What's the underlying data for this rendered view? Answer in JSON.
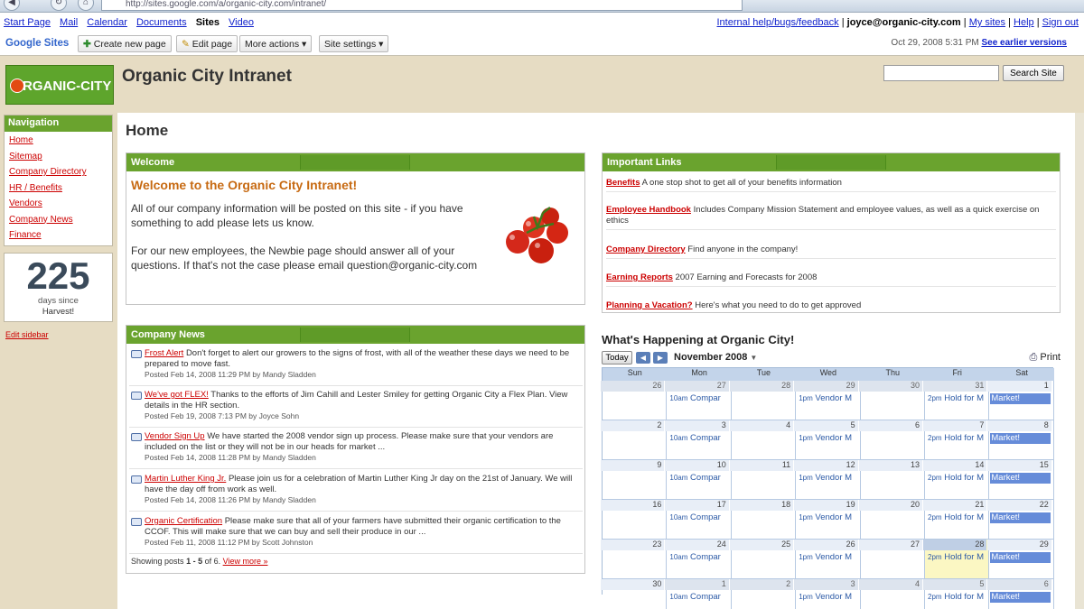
{
  "browser": {
    "url": "http://sites.google.com/a/organic-city.com/intranet/"
  },
  "gbar": {
    "left_links": [
      "Start Page",
      "Mail",
      "Calendar",
      "Documents",
      "Sites",
      "Video"
    ],
    "help_link": "Internal help/bugs/feedback",
    "account": "joyce@organic-city.com",
    "my_sites": "My sites",
    "help": "Help",
    "sign_out": "Sign out"
  },
  "sites_toolbar": {
    "brand": "Google Sites",
    "create_page": "Create new page",
    "edit_page": "Edit page",
    "more_actions": "More actions",
    "site_settings": "Site settings",
    "timestamp": "Oct 29, 2008 5:31 PM",
    "earlier_versions": "See earlier versions"
  },
  "header": {
    "logo_text": "RGANIC-CITY",
    "site_title": "Organic City Intranet",
    "search_placeholder": "",
    "search_button": "Search Site"
  },
  "sidebar": {
    "nav_title": "Navigation",
    "items": [
      "Home",
      "Sitemap",
      "Company Directory",
      "HR / Benefits",
      "Vendors",
      "Company News",
      "Finance"
    ],
    "counter_value": "225",
    "counter_caption1": "days since",
    "counter_caption2": "Harvest!",
    "edit_sidebar": "Edit sidebar"
  },
  "page": {
    "title": "Home"
  },
  "welcome": {
    "header": "Welcome",
    "title": "Welcome to the Organic City Intranet!",
    "para1": "All of our company information will be posted on this site - if you have something to add please lets us know.",
    "para2": "For our new employees, the Newbie page should answer all of your questions. If that's not the case please email question@organic-city.com"
  },
  "news": {
    "header": "Company News",
    "items": [
      {
        "title": "Frost Alert",
        "text": "Don't forget to alert our growers to the signs of frost, with all of the weather these days we need to be prepared to move fast.",
        "meta": "Posted Feb 14, 2008 11:29 PM by Mandy Sladden"
      },
      {
        "title": "We've got FLEX!",
        "text": "Thanks to the efforts of Jim Cahill and Lester Smiley for getting Organic City a Flex Plan. View details in the HR section.",
        "meta": "Posted Feb 19, 2008 7:13 PM by Joyce Sohn"
      },
      {
        "title": "Vendor Sign Up",
        "text": "We have started the 2008 vendor sign up process. Please make sure that your vendors are included on the list or they will not be in our heads for market ...",
        "meta": "Posted Feb 14, 2008 11:28 PM by Mandy Sladden"
      },
      {
        "title": "Martin Luther King Jr.",
        "text": "Please join us for a celebration of Martin Luther King Jr day on the 21st of January. We will have the day off from work as well.",
        "meta": "Posted Feb 14, 2008 11:26 PM by Mandy Sladden"
      },
      {
        "title": "Organic Certification",
        "text": "Please make sure that all of your farmers have submitted their organic certification to the CCOF. This will make sure that we can buy and sell their produce in our ...",
        "meta": "Posted Feb 11, 2008 11:12 PM by Scott Johnston"
      }
    ],
    "footer_prefix": "Showing posts",
    "footer_range": "1 - 5",
    "footer_of": "of 6.",
    "view_more": "View more »"
  },
  "links": {
    "header": "Important Links",
    "items": [
      {
        "title": "Benefits",
        "text": "A one stop shot to get all of your benefits information"
      },
      {
        "title": "Employee Handbook",
        "text": "Includes Company Mission Statement and employee values, as well as a quick exercise on ethics"
      },
      {
        "title": "Company Directory",
        "text": "Find anyone in the company!"
      },
      {
        "title": "Earning Reports",
        "text": "2007 Earning and Forecasts for 2008"
      },
      {
        "title": "Planning a Vacation?",
        "text": "Here's what you need to do to get approved"
      }
    ]
  },
  "calendar": {
    "title": "What's Happening at Organic City!",
    "today": "Today",
    "month": "November 2008",
    "print": "Print",
    "days": [
      "Sun",
      "Mon",
      "Tue",
      "Wed",
      "Thu",
      "Fri",
      "Sat"
    ],
    "weeks": [
      [
        "26",
        "27",
        "28",
        "29",
        "30",
        "31",
        "1"
      ],
      [
        "2",
        "3",
        "4",
        "5",
        "6",
        "7",
        "8"
      ],
      [
        "9",
        "10",
        "11",
        "12",
        "13",
        "14",
        "15"
      ],
      [
        "16",
        "17",
        "18",
        "19",
        "20",
        "21",
        "22"
      ],
      [
        "23",
        "24",
        "25",
        "26",
        "27",
        "28",
        "29"
      ],
      [
        "30",
        "1",
        "2",
        "3",
        "4",
        "5",
        "6"
      ]
    ],
    "event_mon_time": "10am",
    "event_mon": "Compar",
    "event_wed_time": "1pm",
    "event_wed": "Vendor M",
    "event_fri_time": "2pm",
    "event_fri": "Hold for M",
    "event_sat": "Market!"
  },
  "colors": {
    "accent_green": "#6aa32e",
    "title_orange": "#c76a12",
    "link_red": "#cc0000",
    "calendar_blue": "#668cd9"
  }
}
